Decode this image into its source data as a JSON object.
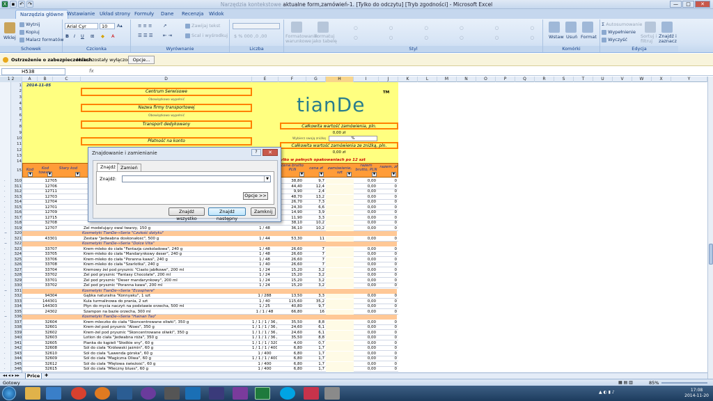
{
  "titlebar": {
    "title_faded": "Narzędzia kontekstowe",
    "title": "aktualne form,zamówień-1. [Tylko do odczytu] [Tryb zgodności] - Microsoft Excel",
    "minimize": "—",
    "maximize": "□",
    "close": "✕"
  },
  "tabs": [
    "Narzędzia główne",
    "Wstawianie",
    "Układ strony",
    "Formuły",
    "Dane",
    "Recenzja",
    "Widok"
  ],
  "ribbon": {
    "schowek": {
      "paste": "Wklej",
      "cut": "Wytnij",
      "copy": "Kopiuj",
      "painter": "Malarz formatów",
      "label": "Schowek"
    },
    "czcionka": {
      "font": "Arial Cyr",
      "size": "10",
      "label": "Czcionka"
    },
    "wyrownanie": {
      "wrap": "Zawijaj tekst",
      "merge": "Scal i wyśrodkuj",
      "label": "Wyrównanie"
    },
    "liczba": {
      "format": "",
      "label": "Liczba"
    },
    "styl": {
      "cond": "Formatowanie warunkowe",
      "table": "Formatuj jako tabelę",
      "label": "Styl"
    },
    "komorki": {
      "insert": "Wstaw",
      "delete": "Usuń",
      "format": "Format",
      "label": "Komórki"
    },
    "edycja": {
      "autosum": "Autosumowanie",
      "fill": "Wypełnienie",
      "clear": "Wyczyść",
      "sort": "Sortuj i filtruj",
      "find": "Znajdź i zaznacz",
      "label": "Edycja"
    }
  },
  "security": {
    "title": "Ostrzeżenie o zabezpieczeniach",
    "message": "Makra zostały wyłączone.",
    "options_button": "Opcje..."
  },
  "formula": {
    "namebox": "H538",
    "fx": "fx",
    "value": ""
  },
  "columns": [
    "A",
    "B",
    "C",
    "D",
    "E",
    "F",
    "G",
    "H",
    "I",
    "J",
    "K",
    "L",
    "M",
    "N",
    "O",
    "P",
    "Q",
    "R",
    "S",
    "T",
    "U",
    "V",
    "W",
    "X",
    "Y"
  ],
  "header_block": {
    "date": "2014-11-05",
    "box1": "Centrum Serwisowe",
    "hint1": "Obowiązkowo wypełnić",
    "box2": "Nazwa firmy transportowej",
    "hint2": "Obowiązkowo wypełnić",
    "box3": "Transport dedykowany",
    "box4": "Płatność na konto",
    "total_label": "Całkowita wartość zamówienia, pln.",
    "total_value": "0,00 zł",
    "discount_label": "Wybierz swoją zniżkę",
    "discount_value": "%",
    "total_disc_label": "Całkowita wartość zamówienia ze zniżką, pln.",
    "total_disc_value": "0,00 zł",
    "note": "...mowienie tylko w pełnych opakowaniach po 12 szt",
    "logo": "tianDe",
    "tm": "TM"
  },
  "table_headers": [
    "Kod",
    "Kod towaru",
    "Stary kod",
    "",
    "",
    "cena brutto PLN",
    "cena zł",
    "zamówienie, szt",
    "razem brutto, PLN",
    "razem, zł"
  ],
  "rows": [
    {
      "n": "310",
      "code": "12705",
      "name": "",
      "pack": "",
      "price": "38,80",
      "pz": "9,7",
      "sum": "0,00",
      "s2": "0"
    },
    {
      "n": "311",
      "code": "12706",
      "name": "",
      "pack": "",
      "price": "44,40",
      "pz": "12,4",
      "sum": "0,00",
      "s2": "0"
    },
    {
      "n": "312",
      "code": "12711",
      "name": "",
      "pack": "",
      "price": "9,90",
      "pz": "2,4",
      "sum": "0,00",
      "s2": "0"
    },
    {
      "n": "313",
      "code": "12703",
      "name": "",
      "pack": "",
      "price": "48,70",
      "pz": "13,2",
      "sum": "0,00",
      "s2": "0"
    },
    {
      "n": "314",
      "code": "12704",
      "name": "",
      "pack": "",
      "price": "26,70",
      "pz": "7,3",
      "sum": "0,00",
      "s2": "0"
    },
    {
      "n": "315",
      "code": "12701",
      "name": "",
      "pack": "",
      "price": "24,30",
      "pz": "6,6",
      "sum": "0,00",
      "s2": "0"
    },
    {
      "n": "316",
      "code": "12709",
      "name": "",
      "pack": "",
      "price": "14,90",
      "pz": "3,9",
      "sum": "0,00",
      "s2": "0"
    },
    {
      "n": "317",
      "code": "12715",
      "name": "",
      "pack": "",
      "price": "11,90",
      "pz": "3,3",
      "sum": "0,00",
      "s2": "0"
    },
    {
      "n": "318",
      "code": "32708",
      "name": "",
      "pack": "",
      "price": "38,10",
      "pz": "10,2",
      "sum": "0,00",
      "s2": "0"
    },
    {
      "n": "319",
      "code": "12707",
      "name": "Żel modelujący owal twarzy, 150 g",
      "pack": "1 / 48",
      "price": "36,10",
      "pz": "10,2",
      "sum": "0,00",
      "s2": "0"
    },
    {
      "n": "320",
      "cat": "Kosmetyki TianDe-»Seria \"Czułość dotyku\""
    },
    {
      "n": "321",
      "code": "43301",
      "name": "Zestaw \"Jedwabna doskonałość\", 500 g",
      "pack": "1 / 44",
      "price": "53,30",
      "pz": "11",
      "sum": "0,00",
      "s2": "0"
    },
    {
      "n": "322",
      "cat": "Kosmetyki TianDe-»Seria \"Dolce Vita\""
    },
    {
      "n": "323",
      "code": "33707",
      "name": "Krem-mleko do ciała \"Fantazja czekoladowa\", 240 g",
      "pack": "1 / 48",
      "price": "26,60",
      "pz": "7",
      "sum": "0,00",
      "s2": "0"
    },
    {
      "n": "324",
      "code": "33705",
      "name": "Krem-mleko do ciała \"Mandarynkowy deser\", 240 g",
      "pack": "1 / 48",
      "price": "26,60",
      "pz": "7",
      "sum": "0,00",
      "s2": "0"
    },
    {
      "n": "325",
      "code": "33706",
      "name": "Krem-mleko do ciała \"Poranna kawa\", 240 g",
      "pack": "1 / 48",
      "price": "26,60",
      "pz": "7",
      "sum": "0,00",
      "s2": "0"
    },
    {
      "n": "326",
      "code": "33708",
      "name": "Krem-mleko do ciała \"Szarlotka\", 240 g",
      "pack": "1 / 40",
      "price": "26,60",
      "pz": "7",
      "sum": "0,00",
      "s2": "0"
    },
    {
      "n": "327",
      "code": "33704",
      "name": "Kremowy żel pod prysznic \"Ciasto jabłkowe\", 200 ml",
      "pack": "1 / 24",
      "price": "15,20",
      "pz": "3,2",
      "sum": "0,00",
      "s2": "0"
    },
    {
      "n": "328",
      "code": "33702",
      "name": "Żel pod prysznic \"Fantasy Chocolate\", 200 ml",
      "pack": "1 / 24",
      "price": "15,20",
      "pz": "3,2",
      "sum": "0,00",
      "s2": "0"
    },
    {
      "n": "329",
      "code": "33701",
      "name": "Żel pod prysznic \"Deser mandarynkowy\", 200 ml",
      "pack": "1 / 24",
      "price": "15,20",
      "pz": "3,2",
      "sum": "0,00",
      "s2": "0"
    },
    {
      "n": "330",
      "code": "33702",
      "name": "Żel pod prysznic \"Poranna kawa\", 200 ml",
      "pack": "1 / 24",
      "price": "15,20",
      "pz": "3,2",
      "sum": "0,00",
      "s2": "0"
    },
    {
      "n": "331",
      "cat": "Kosmetyki TianDe-»Seria \"Ecosphere\""
    },
    {
      "n": "332",
      "code": "94304",
      "name": "Gąbka naturalna \"Konnyaku\", 1 szt",
      "pack": "1 / 288",
      "price": "13,50",
      "pz": "3,3",
      "sum": "0,00",
      "s2": "0"
    },
    {
      "n": "333",
      "code": "144301",
      "name": "Kula turmalinowa do prania, 2 szt",
      "pack": "1 / 40",
      "price": "115,60",
      "pz": "35,2",
      "sum": "0,00",
      "s2": "0"
    },
    {
      "n": "334",
      "code": "144303",
      "name": "Płyn do mycia naczyń na podstawie orzecha, 500 ml",
      "pack": "1 / 25",
      "price": "40,80",
      "pz": "9,7",
      "sum": "0,00",
      "s2": "0"
    },
    {
      "n": "335",
      "code": "24302",
      "name": "Szampon na bazie orzecha, 300 ml",
      "pack": "1 / 1 / 48",
      "price": "66,80",
      "pz": "16",
      "sum": "0,00",
      "s2": "0"
    },
    {
      "n": "336",
      "cat": "Kosmetyki TianDe-»Seria \"Hainan Tao\""
    },
    {
      "n": "337",
      "code": "32604",
      "name": "Krem-mleczko do ciała \"Skoncentrowane oliwki\", 350 g",
      "pack": "1 / 1 / 1 / 36 / 36",
      "price": "35,50",
      "pz": "8,8",
      "sum": "0,00",
      "s2": "0"
    },
    {
      "n": "338",
      "code": "32601",
      "name": "Krem-żel pod prysznic \"Aloes\", 350 g",
      "pack": "1 / 1 / 1 / 36 / 36",
      "price": "24,60",
      "pz": "6,1",
      "sum": "0,00",
      "s2": "0"
    },
    {
      "n": "339",
      "code": "32602",
      "name": "Krem-żel pod prysznic \"Skoncentrowane oliwki\", 350 g",
      "pack": "1 / 1 / 1 / 36 / 36",
      "price": "24,60",
      "pz": "6,1",
      "sum": "0,00",
      "s2": "0"
    },
    {
      "n": "340",
      "code": "32603",
      "name": "Lotion do ciała \"Jedwabna róża\", 350 g",
      "pack": "1 / 1 / 1 / 36 / 36",
      "price": "35,50",
      "pz": "8,8",
      "sum": "0,00",
      "s2": "0"
    },
    {
      "n": "341",
      "code": "32605",
      "name": "Pianka do kąpieli \"Słodkie sny\", 60 g",
      "pack": "1 / 1 / 1 / 320 / 320",
      "price": "4,00",
      "pz": "0,7",
      "sum": "0,00",
      "s2": "0"
    },
    {
      "n": "342",
      "code": "32608",
      "name": "Sól do ciała \"Królewski jaśmin\", 60 g",
      "pack": "1 / 1 / 1 / 400 / 400",
      "price": "6,80",
      "pz": "1,7",
      "sum": "0,00",
      "s2": "0"
    },
    {
      "n": "343",
      "code": "32610",
      "name": "Sól do ciała \"Lawenda górska\", 60 g",
      "pack": "1 / 400",
      "price": "6,80",
      "pz": "1,7",
      "sum": "0,00",
      "s2": "0"
    },
    {
      "n": "344",
      "code": "32609",
      "name": "Sól do ciała \"Magiczna Oliwa\", 60 g",
      "pack": "1 / 1 / 1 / 400 / 400",
      "price": "6,80",
      "pz": "1,7",
      "sum": "0,00",
      "s2": "0"
    },
    {
      "n": "345",
      "code": "32612",
      "name": "Sól do ciała \"Miętowa świeżość\", 60 g",
      "pack": "1 / 400",
      "price": "6,80",
      "pz": "1,7",
      "sum": "0,00",
      "s2": "0"
    },
    {
      "n": "346",
      "code": "32615",
      "name": "Sól do ciała \"Mleczny blues\", 60 g",
      "pack": "1 / 400",
      "price": "6,80",
      "pz": "1,7",
      "sum": "0,00",
      "s2": "0"
    }
  ],
  "sheet_tab": "Price",
  "status": {
    "ready": "Gotowy",
    "zoom": "85%"
  },
  "dialog": {
    "title": "Znajdowanie i zamienianie",
    "help": "?",
    "close": "✕",
    "tab_find": "Znajdź",
    "tab_replace": "Zamień",
    "find_label": "Znajdź:",
    "find_value": "",
    "options": "Opcje >>",
    "find_all": "Znajdź wszystko",
    "find_next": "Znajdź następny",
    "close_btn": "Zamknij"
  },
  "taskbar": {
    "time": "17:08",
    "date": "2014-11-20"
  }
}
